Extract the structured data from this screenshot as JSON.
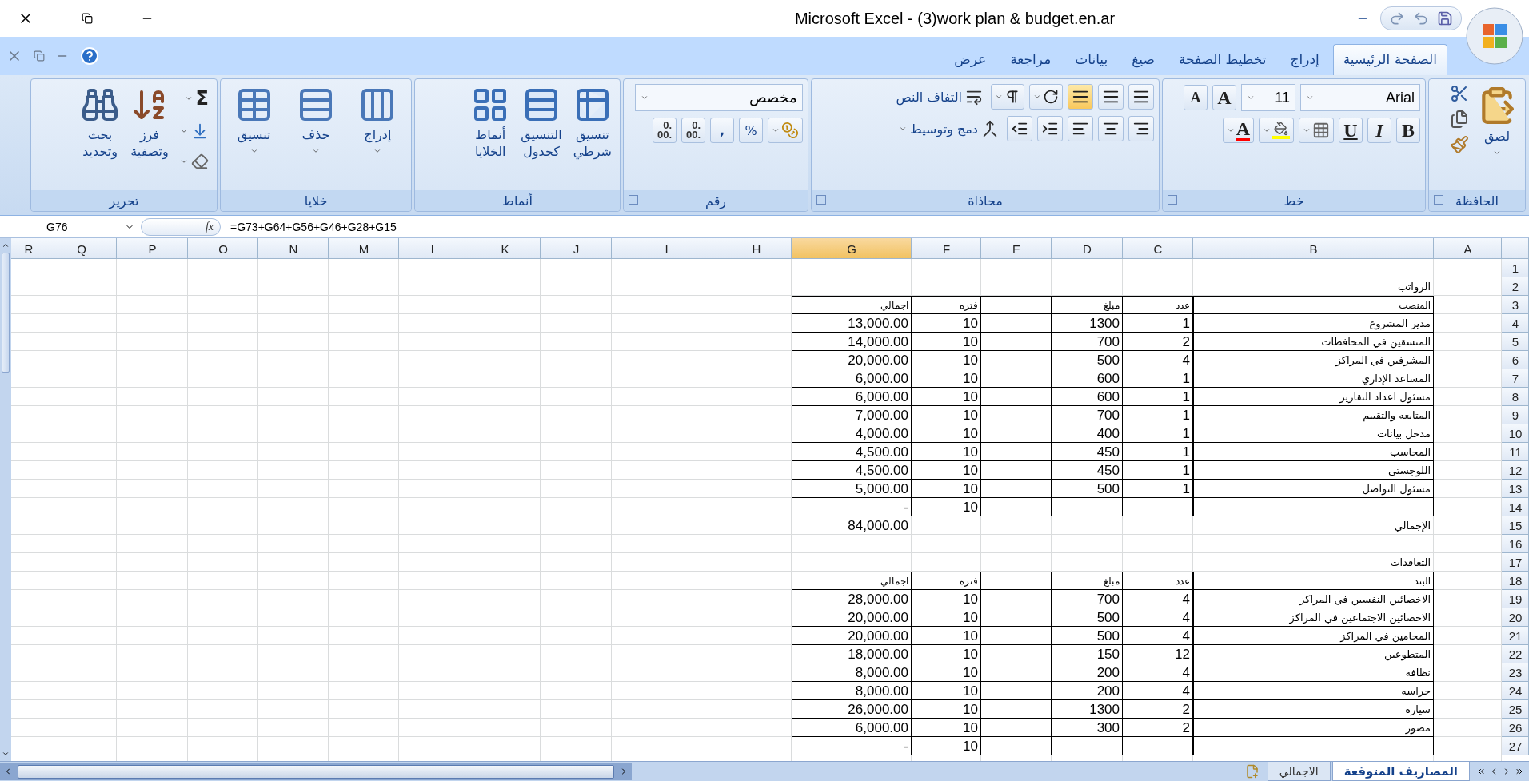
{
  "window": {
    "title": "Microsoft Excel - (3)work plan & budget.en.ar"
  },
  "ribbon_tabs": [
    {
      "label": "الصفحة الرئيسية",
      "selected": true
    },
    {
      "label": "إدراج",
      "selected": false
    },
    {
      "label": "تخطيط الصفحة",
      "selected": false
    },
    {
      "label": "صيغ",
      "selected": false
    },
    {
      "label": "بيانات",
      "selected": false
    },
    {
      "label": "مراجعة",
      "selected": false
    },
    {
      "label": "عرض",
      "selected": false
    }
  ],
  "ribbon": {
    "clipboard": {
      "label": "الحافظة",
      "paste": "لصق"
    },
    "font": {
      "label": "خط",
      "font_name": "Arial",
      "font_size": "11",
      "grow": "A",
      "shrink": "A",
      "styles": [
        "B",
        "I",
        "U"
      ],
      "color_letter": "A"
    },
    "alignment": {
      "label": "محاذاة",
      "wrap_text": "التفاف النص",
      "merge_center": "دمج وتوسيط",
      "vertical": [
        {
          "selected": false
        },
        {
          "selected": false
        },
        {
          "selected": true
        }
      ]
    },
    "number": {
      "label": "رقم",
      "format": "مخصص",
      "percent": "%",
      "comma": ",",
      "decimals": [
        {
          "top": ".0",
          "bottom": ".00"
        },
        {
          "top": ".0",
          "bottom": ".00"
        }
      ]
    },
    "styles": {
      "label": "أنماط",
      "buttons": [
        "تنسيق\nشرطي",
        "التنسيق\nكجدول",
        "أنماط\nالخلايا"
      ]
    },
    "cells": {
      "label": "خلايا",
      "buttons": [
        "إدراج",
        "حذف",
        "تنسيق"
      ]
    },
    "editing": {
      "label": "تحرير",
      "sum": "Σ",
      "buttons": [
        "فرز\nوتصفية",
        "بحث\nوتحديد"
      ]
    }
  },
  "formula_bar": {
    "name_box": "G76",
    "fx": "fx",
    "formula": "=G73+G64+G56+G46+G28+G15"
  },
  "sheet": {
    "columns": [
      {
        "label": "A",
        "selected": false
      },
      {
        "label": "B",
        "selected": false
      },
      {
        "label": "C",
        "selected": false
      },
      {
        "label": "D",
        "selected": false
      },
      {
        "label": "E",
        "selected": false
      },
      {
        "label": "F",
        "selected": false
      },
      {
        "label": "G",
        "selected": true
      },
      {
        "label": "H",
        "selected": false
      },
      {
        "label": "I",
        "selected": false
      },
      {
        "label": "J",
        "selected": false
      },
      {
        "label": "K",
        "selected": false
      },
      {
        "label": "L",
        "selected": false
      },
      {
        "label": "M",
        "selected": false
      },
      {
        "label": "N",
        "selected": false
      },
      {
        "label": "O",
        "selected": false
      },
      {
        "label": "P",
        "selected": false
      },
      {
        "label": "Q",
        "selected": false
      },
      {
        "label": "R",
        "selected": false
      }
    ],
    "rows": [
      {
        "number": "1",
        "kind": "plain",
        "cells": {}
      },
      {
        "number": "2",
        "kind": "plain",
        "cells": {
          "b": "الرواتب"
        }
      },
      {
        "number": "3",
        "kind": "header",
        "cells": {
          "b": "المنصب",
          "c": "عدد",
          "d": "مبلغ",
          "f": "فتره",
          "g": "اجمالي"
        }
      },
      {
        "number": "4",
        "kind": "item",
        "cells": {
          "b": "مدير المشروع",
          "c": "1",
          "d": "1300",
          "f": "10",
          "g": "13,000.00"
        }
      },
      {
        "number": "5",
        "kind": "item",
        "cells": {
          "b": "المنسقين في المحافظات",
          "c": "2",
          "d": "700",
          "f": "10",
          "g": "14,000.00"
        }
      },
      {
        "number": "6",
        "kind": "item",
        "cells": {
          "b": "المشرفين  في المراكز",
          "c": "4",
          "d": "500",
          "f": "10",
          "g": "20,000.00"
        }
      },
      {
        "number": "7",
        "kind": "item",
        "cells": {
          "b": "المساعد  الإداري",
          "c": "1",
          "d": "600",
          "f": "10",
          "g": "6,000.00"
        }
      },
      {
        "number": "8",
        "kind": "item",
        "cells": {
          "b": "مسئول اعداد التقارير",
          "c": "1",
          "d": "600",
          "f": "10",
          "g": "6,000.00"
        }
      },
      {
        "number": "9",
        "kind": "item",
        "cells": {
          "b": "المتابعه والتقييم",
          "c": "1",
          "d": "700",
          "f": "10",
          "g": "7,000.00"
        }
      },
      {
        "number": "10",
        "kind": "item",
        "cells": {
          "b": "مدخل بيانات",
          "c": "1",
          "d": "400",
          "f": "10",
          "g": "4,000.00"
        }
      },
      {
        "number": "11",
        "kind": "item",
        "cells": {
          "b": "المحاسب",
          "c": "1",
          "d": "450",
          "f": "10",
          "g": "4,500.00"
        }
      },
      {
        "number": "12",
        "kind": "item",
        "cells": {
          "b": "اللوجستي",
          "c": "1",
          "d": "450",
          "f": "10",
          "g": "4,500.00"
        }
      },
      {
        "number": "13",
        "kind": "item",
        "cells": {
          "b": "مسئول التواصل",
          "c": "1",
          "d": "500",
          "f": "10",
          "g": "5,000.00"
        }
      },
      {
        "number": "14",
        "kind": "item",
        "cells": {
          "f": "10",
          "g": "-"
        }
      },
      {
        "number": "15",
        "kind": "plain",
        "cells": {
          "b": "الإجمالي",
          "g": "84,000.00"
        }
      },
      {
        "number": "16",
        "kind": "plain",
        "cells": {}
      },
      {
        "number": "17",
        "kind": "plain",
        "cells": {
          "b": "التعاقدات"
        }
      },
      {
        "number": "18",
        "kind": "header",
        "cells": {
          "b": "البند",
          "c": "عدد",
          "d": "مبلغ",
          "f": "فتره",
          "g": "اجمالي"
        }
      },
      {
        "number": "19",
        "kind": "item",
        "cells": {
          "b": "الاخصائين النفسين في المراكز",
          "c": "4",
          "d": "700",
          "f": "10",
          "g": "28,000.00"
        }
      },
      {
        "number": "20",
        "kind": "item",
        "cells": {
          "b": "الاخصائين الاجتماعين في المراكز",
          "c": "4",
          "d": "500",
          "f": "10",
          "g": "20,000.00"
        }
      },
      {
        "number": "21",
        "kind": "item",
        "cells": {
          "b": "المحامين في المراكز",
          "c": "4",
          "d": "500",
          "f": "10",
          "g": "20,000.00"
        }
      },
      {
        "number": "22",
        "kind": "item",
        "cells": {
          "b": "المتطوعين",
          "c": "12",
          "d": "150",
          "f": "10",
          "g": "18,000.00"
        }
      },
      {
        "number": "23",
        "kind": "item",
        "cells": {
          "b": "نظافه",
          "c": "4",
          "d": "200",
          "f": "10",
          "g": "8,000.00"
        }
      },
      {
        "number": "24",
        "kind": "item",
        "cells": {
          "b": "حراسه",
          "c": "4",
          "d": "200",
          "f": "10",
          "g": "8,000.00"
        }
      },
      {
        "number": "25",
        "kind": "item",
        "cells": {
          "b": "سياره",
          "c": "2",
          "d": "1300",
          "f": "10",
          "g": "26,000.00"
        }
      },
      {
        "number": "26",
        "kind": "item",
        "cells": {
          "b": "مصور",
          "c": "2",
          "d": "300",
          "f": "10",
          "g": "6,000.00"
        }
      },
      {
        "number": "27",
        "kind": "item",
        "cells": {
          "f": "10",
          "g": "-"
        }
      }
    ]
  },
  "sheet_tabs": [
    {
      "label": "المصاريف المتوقعة",
      "selected": true
    },
    {
      "label": "الاجمالي",
      "selected": false
    }
  ]
}
